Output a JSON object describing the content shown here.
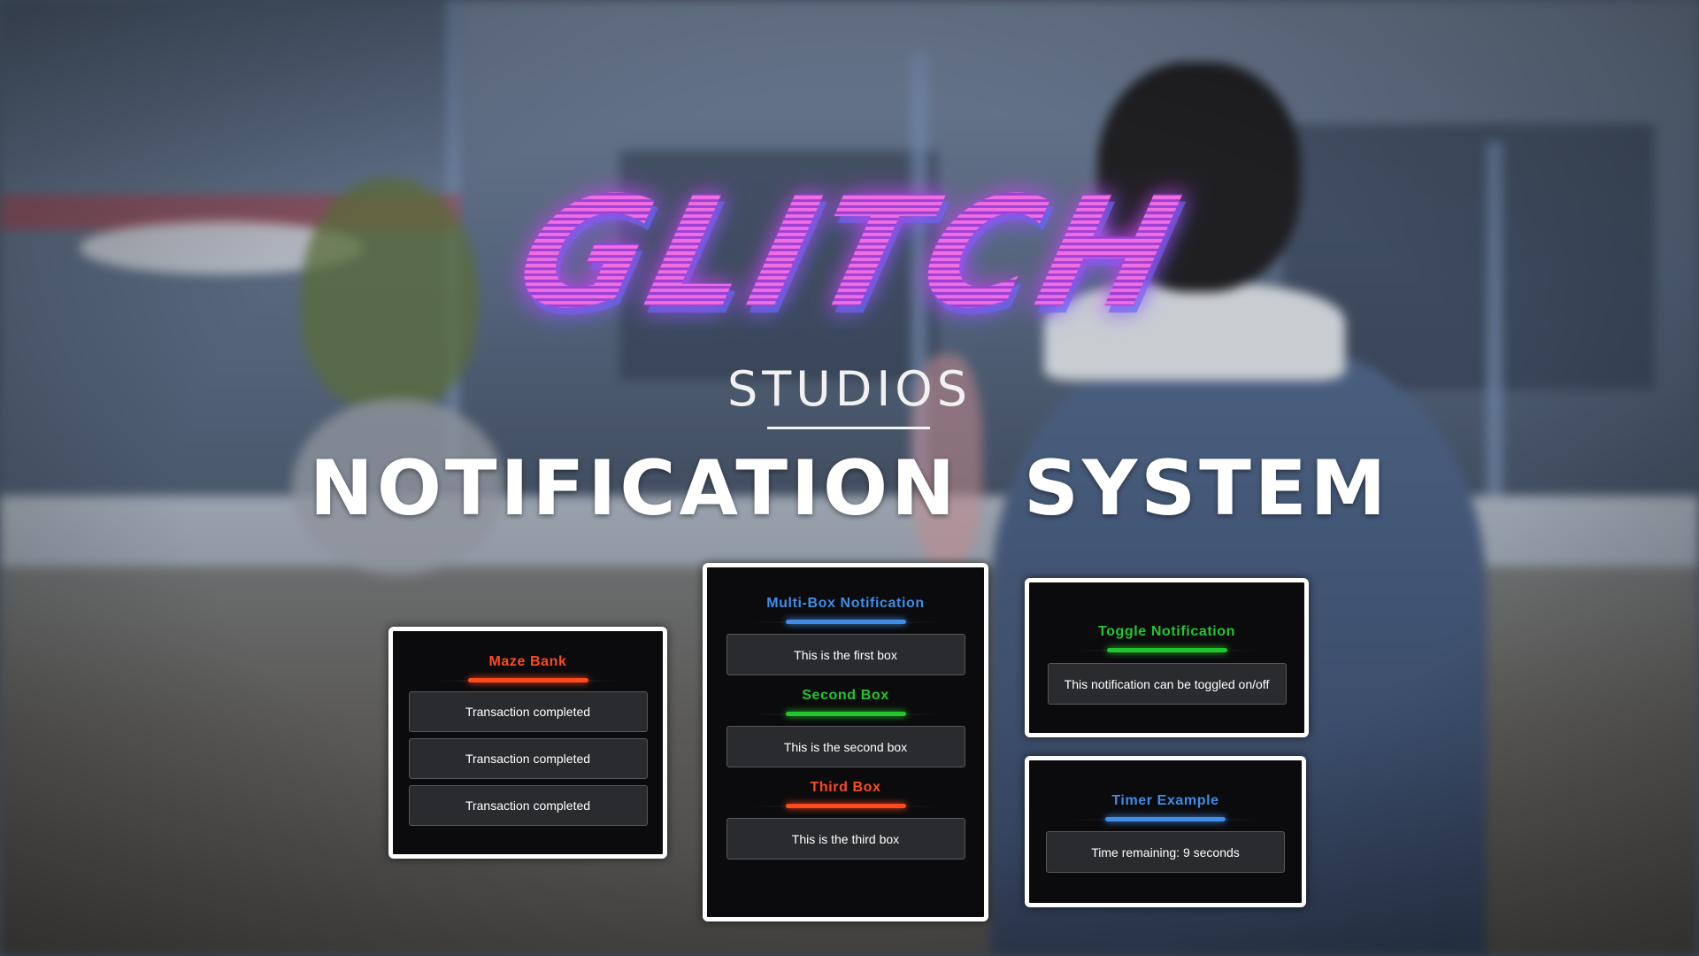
{
  "branding": {
    "logo_text": "GLITCH",
    "studios_text": "STUDIOS",
    "headline": "NOTIFICATION SYSTEM"
  },
  "colors": {
    "orange": "#ff4a1c",
    "blue": "#3f8de6",
    "green": "#22c52e",
    "panel_bg": "#0b0b0d",
    "box_bg": "#2a2b2e"
  },
  "panels": {
    "maze_bank": {
      "title": "Maze Bank",
      "accent": "#ff4a1c",
      "messages": [
        "Transaction completed",
        "Transaction completed",
        "Transaction completed"
      ]
    },
    "multi_box": {
      "title": "Multi-Box Notification",
      "accent": "#3f8de6",
      "first_message": "This is the first box",
      "second_title": "Second Box",
      "second_accent": "#22c52e",
      "second_message": "This is the second box",
      "third_title": "Third Box",
      "third_accent": "#ff4a1c",
      "third_message": "This is the third box"
    },
    "toggle": {
      "title": "Toggle Notification",
      "accent": "#22c52e",
      "message": "This notification can be toggled on/off"
    },
    "timer": {
      "title": "Timer Example",
      "accent": "#3f8de6",
      "message": "Time remaining: 9 seconds"
    }
  }
}
